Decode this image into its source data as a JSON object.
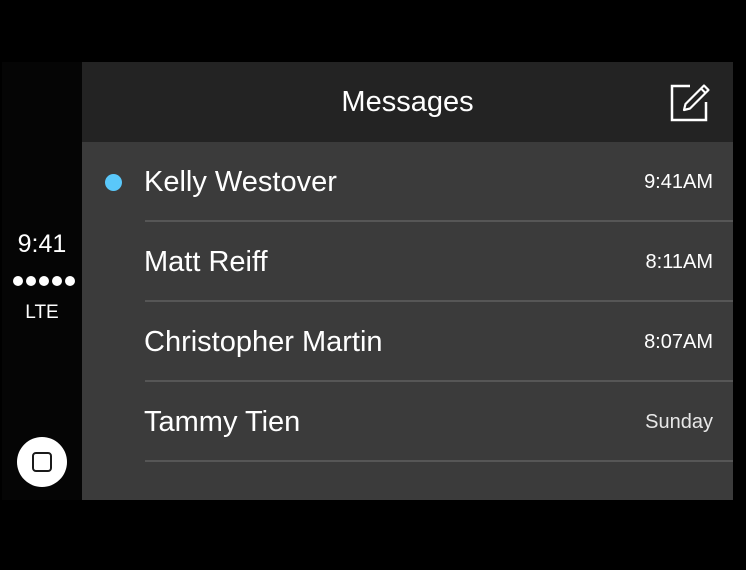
{
  "status": {
    "time": "9:41",
    "signal_bars": 5,
    "network": "LTE"
  },
  "header": {
    "title": "Messages",
    "compose_icon": "compose-icon"
  },
  "messages": [
    {
      "name": "Kelly Westover",
      "time": "9:41AM",
      "unread": true
    },
    {
      "name": "Matt Reiff",
      "time": "8:11AM",
      "unread": false
    },
    {
      "name": "Christopher Martin",
      "time": "8:07AM",
      "unread": false
    },
    {
      "name": "Tammy Tien",
      "time": "Sunday",
      "unread": false
    }
  ],
  "home_button_icon": "home-square-icon",
  "colors": {
    "background": "#3b3b3b",
    "header": "#232323",
    "sidebar": "#050505",
    "unread_dot": "#5ac8fa",
    "divider": "#565656"
  }
}
